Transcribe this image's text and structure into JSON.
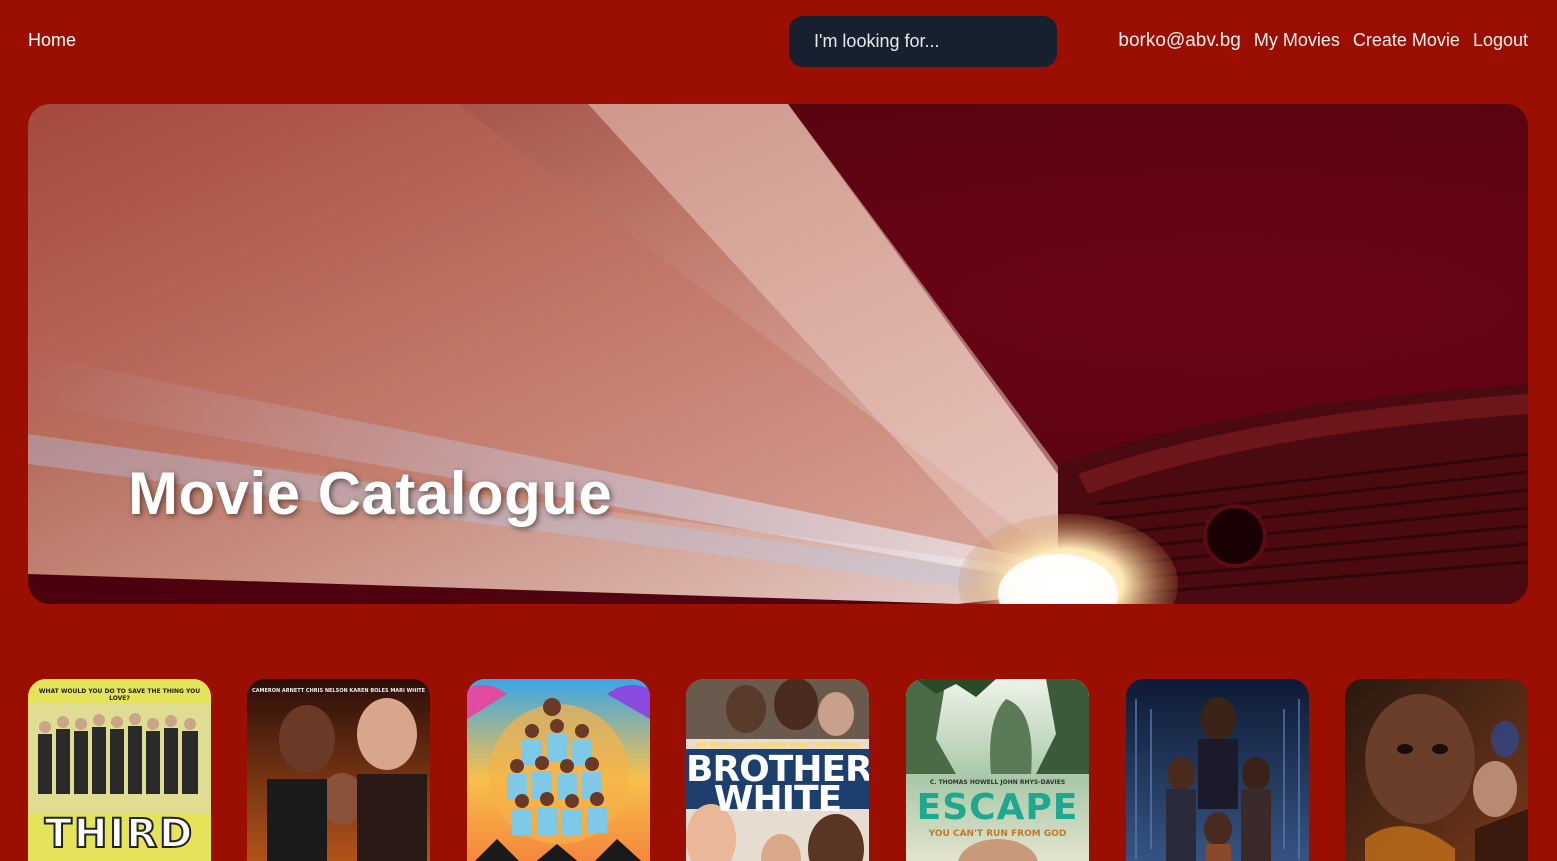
{
  "nav": {
    "home": "Home",
    "search_placeholder": "I'm looking for...",
    "email": "borko@abv.bg",
    "my_movies": "My Movies",
    "create_movie": "Create Movie",
    "logout": "Logout"
  },
  "hero": {
    "title": "Movie Catalogue"
  },
  "posters": [
    {
      "top_text": "WHAT WOULD YOU DO TO SAVE THE THING YOU LOVE?",
      "main_text": "THIRD",
      "bg": "#e8e74a"
    },
    {
      "top_text": "CAMERON ARNETT   CHRIS NELSON   KAREN BOLES   MARI WHITE",
      "main_text": "",
      "bg": "#5a2418"
    },
    {
      "top_text": "",
      "main_text": "",
      "bg": "#f59e2c"
    },
    {
      "top_text": "All Things Are Possible When You Believe",
      "main_text": "BROTHER WHITE",
      "bg": "#1c3f6e"
    },
    {
      "top_text": "C. THOMAS HOWELL   JOHN RHYS-DAVIES",
      "main_text": "ESCAPE",
      "sub_text": "YOU CAN'T RUN FROM GOD",
      "bg": "#d9e6d8"
    },
    {
      "top_text": "",
      "main_text": "",
      "bg": "#1b2a4a"
    },
    {
      "top_text": "",
      "main_text": "",
      "bg": "#3a2216"
    }
  ],
  "colors": {
    "background": "#9b0f02",
    "search_bg": "#17202e"
  }
}
